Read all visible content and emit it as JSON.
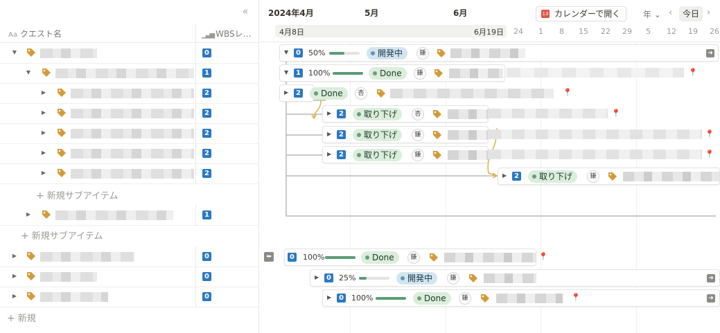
{
  "table": {
    "collapse_icon": "«",
    "col_name_icon": "Aa",
    "col_name": "クエスト名",
    "col_wbs": "WBSレ…",
    "rows": [
      {
        "wbs": "0"
      },
      {
        "wbs": "1"
      },
      {
        "wbs": "2"
      },
      {
        "wbs": "2"
      },
      {
        "wbs": "2"
      },
      {
        "wbs": "2"
      },
      {
        "wbs": "2"
      },
      {
        "wbs": "1"
      },
      {
        "wbs": "0"
      },
      {
        "wbs": "0"
      },
      {
        "wbs": "0"
      }
    ],
    "new_sub_item": "新規サブアイテム",
    "new_item": "新規"
  },
  "gantt": {
    "months": [
      "2024年4月",
      "5月",
      "6月"
    ],
    "open_calendar": "カレンダーで開く",
    "calendar_icon_text": "13",
    "view_select": "年",
    "prev": "‹",
    "next": "›",
    "today": "今日",
    "range_start": "4月8日",
    "range_end": "6月19日",
    "days": [
      "24",
      "1",
      "8",
      "15",
      "22",
      "29",
      "5",
      "12",
      "19",
      "26"
    ],
    "cards": [
      {
        "wbs": "0",
        "pct": "50%",
        "progress": 0.5,
        "status": "開発中",
        "avatar": "鎌"
      },
      {
        "wbs": "1",
        "pct": "100%",
        "progress": 1.0,
        "status": "Done",
        "avatar": "鎌"
      },
      {
        "wbs": "2",
        "status": "Done",
        "avatar": "杏"
      },
      {
        "wbs": "2",
        "status": "取り下げ",
        "avatar": "杏"
      },
      {
        "wbs": "2",
        "status": "取り下げ",
        "avatar": "鎌"
      },
      {
        "wbs": "2",
        "status": "取り下げ",
        "avatar": "鎌"
      },
      {
        "wbs": "2",
        "status": "取り下げ",
        "avatar": "鎌"
      },
      {
        "wbs": "0",
        "pct": "100%",
        "progress": 1.0,
        "status": "Done",
        "avatar": "鎌"
      },
      {
        "wbs": "0",
        "pct": "25%",
        "progress": 0.25,
        "status": "開発中",
        "avatar": "鎌"
      },
      {
        "wbs": "0",
        "pct": "100%",
        "progress": 1.0,
        "status": "Done",
        "avatar": "鎌"
      }
    ],
    "colors": {
      "wbs_badge": "#2b78c2",
      "done": "#dbeddb",
      "dev": "#d3e5ef",
      "tag": "#d49a3a",
      "arrow": "#e0b14a"
    }
  }
}
